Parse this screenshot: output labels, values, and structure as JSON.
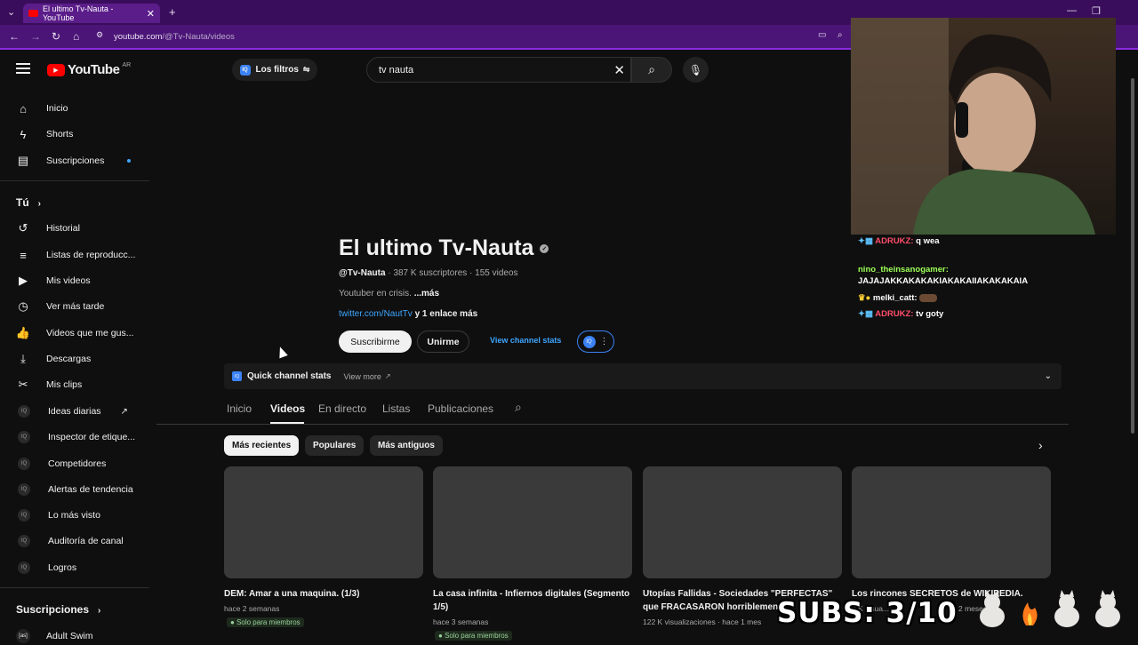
{
  "browser": {
    "tab_title": "El ultimo Tv-Nauta - YouTube",
    "url_host": "youtube.com",
    "url_path": "/@Tv-Nauta/videos"
  },
  "yt": {
    "logo": "YouTube",
    "region": "AR",
    "filters": "Los filtros",
    "search_value": "tv nauta"
  },
  "sidebar": {
    "main": [
      {
        "label": "Inicio"
      },
      {
        "label": "Shorts"
      },
      {
        "label": "Suscripciones"
      }
    ],
    "you_header": "Tú",
    "you": [
      {
        "label": "Historial"
      },
      {
        "label": "Listas de reproducc..."
      },
      {
        "label": "Mis videos"
      },
      {
        "label": "Ver más tarde"
      },
      {
        "label": "Videos que me gus..."
      },
      {
        "label": "Descargas"
      },
      {
        "label": "Mis clips"
      }
    ],
    "ext": [
      {
        "label": "Ideas diarias"
      },
      {
        "label": "Inspector de etique..."
      },
      {
        "label": "Competidores"
      },
      {
        "label": "Alertas de tendencia"
      },
      {
        "label": "Lo más visto"
      },
      {
        "label": "Auditoría de canal"
      },
      {
        "label": "Logros"
      }
    ],
    "subs_header": "Suscripciones",
    "subs_first": "Adult Swim"
  },
  "channel": {
    "name": "El ultimo Tv-Nauta",
    "handle": "@Tv-Nauta",
    "subs": "387 K suscriptores",
    "videos": "155 videos",
    "desc": "Youtuber en crisis.",
    "more": "...más",
    "link": "twitter.com/NautTv",
    "link_more": "y 1 enlace más",
    "subscribe": "Suscribirme",
    "join": "Unirme",
    "stats_link": "View channel stats"
  },
  "quick": {
    "label": "Quick channel stats",
    "view_more": "View more"
  },
  "tabs": [
    {
      "label": "Inicio"
    },
    {
      "label": "Videos"
    },
    {
      "label": "En directo"
    },
    {
      "label": "Listas"
    },
    {
      "label": "Publicaciones"
    }
  ],
  "chips": [
    {
      "label": "Más recientes"
    },
    {
      "label": "Populares"
    },
    {
      "label": "Más antiguos"
    }
  ],
  "videos": [
    {
      "title": "DEM: Amar a una maquina. (1/3)",
      "meta": "hace 2 semanas",
      "badge": "Solo para miembros"
    },
    {
      "title": "La casa infinita - Infiernos digitales (Segmento 1/5)",
      "meta": "hace 3 semanas",
      "badge": "Solo para miembros"
    },
    {
      "title": "Utopías Fallidas - Sociedades \"PERFECTAS\" que FRACASARON horriblemente",
      "meta": "122 K visualizaciones · hace 1 mes"
    },
    {
      "title": "Los rincones SECRETOS de WIKIPEDIA.",
      "meta": "2 K visua...",
      "meta2": "2 meses"
    }
  ],
  "overlay": {
    "subs_goal": "SUBS: 3/10",
    "chat": [
      {
        "user": "ADRUKZ:",
        "msg": "q wea",
        "color": "#ff4d6a"
      },
      {
        "user": "nino_theinsanogamer:",
        "msg": "JAJAJAKKAKAKAKIAKAKAIIAKAKAKAIA",
        "color": "#9cff57"
      },
      {
        "user": "melki_catt:",
        "msg": "",
        "color": "#ffffff"
      },
      {
        "user": "ADRUKZ:",
        "msg": "tv goty",
        "color": "#ff4d6a"
      }
    ]
  }
}
